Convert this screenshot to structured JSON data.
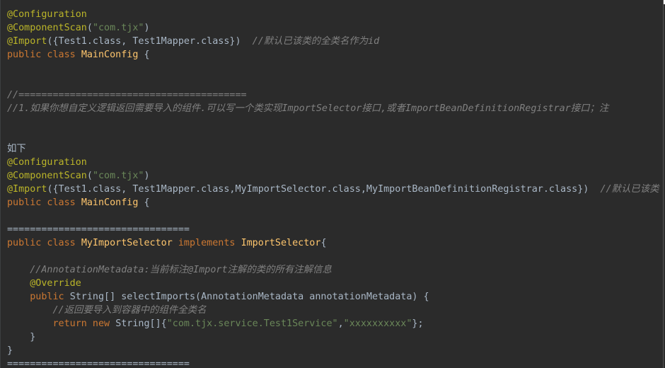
{
  "top_glyph": "ⓘ",
  "lines": [
    [
      {
        "t": "@Configuration",
        "c": "ann"
      }
    ],
    [
      {
        "t": "@ComponentScan",
        "c": "ann"
      },
      {
        "t": "(",
        "c": "pl"
      },
      {
        "t": "\"com.tjx\"",
        "c": "str"
      },
      {
        "t": ")",
        "c": "pl"
      }
    ],
    [
      {
        "t": "@Import",
        "c": "ann"
      },
      {
        "t": "({Test1.class, Test1Mapper.class})  ",
        "c": "pl"
      },
      {
        "t": "//默认已该类的全类名作为id",
        "c": "cm"
      }
    ],
    [
      {
        "t": "public class ",
        "c": "kw"
      },
      {
        "t": "MainConfig",
        "c": "cls"
      },
      {
        "t": " {",
        "c": "pl"
      }
    ],
    [],
    [],
    [
      {
        "t": "//========================================",
        "c": "cm"
      }
    ],
    [
      {
        "t": "//1.如果你想自定义逻辑返回需要导入的组件.可以写一个类实现ImportSelector接口,或者ImportBeanDefinitionRegistrar接口；注",
        "c": "cm"
      }
    ],
    [],
    [],
    [
      {
        "t": "如下",
        "c": "cn"
      }
    ],
    [
      {
        "t": "@Configuration",
        "c": "ann"
      }
    ],
    [
      {
        "t": "@ComponentScan",
        "c": "ann"
      },
      {
        "t": "(",
        "c": "pl"
      },
      {
        "t": "\"com.tjx\"",
        "c": "str"
      },
      {
        "t": ")",
        "c": "pl"
      }
    ],
    [
      {
        "t": "@Import",
        "c": "ann"
      },
      {
        "t": "({Test1.class, Test1Mapper.class,MyImportSelector.class,MyImportBeanDefinitionRegistrar.class})  ",
        "c": "pl"
      },
      {
        "t": "//默认已该类",
        "c": "cm"
      }
    ],
    [
      {
        "t": "public class ",
        "c": "kw"
      },
      {
        "t": "MainConfig",
        "c": "cls"
      },
      {
        "t": " {",
        "c": "pl"
      }
    ],
    [],
    [
      {
        "t": "================================",
        "c": "pl"
      }
    ],
    [
      {
        "t": "public class ",
        "c": "kw"
      },
      {
        "t": "MyImportSelector",
        "c": "cls"
      },
      {
        "t": " implements ",
        "c": "kw"
      },
      {
        "t": "ImportSelector",
        "c": "cls"
      },
      {
        "t": "{",
        "c": "pl"
      }
    ],
    [],
    [
      {
        "t": "    ",
        "c": "pl"
      },
      {
        "t": "//AnnotationMetadata:当前标注@Import注解的类的所有注解信息",
        "c": "cm"
      }
    ],
    [
      {
        "t": "    ",
        "c": "pl"
      },
      {
        "t": "@Override",
        "c": "ann"
      }
    ],
    [
      {
        "t": "    ",
        "c": "pl"
      },
      {
        "t": "public ",
        "c": "kw"
      },
      {
        "t": "String[] selectImports(AnnotationMetadata annotationMetadata) {",
        "c": "pl"
      }
    ],
    [
      {
        "t": "        ",
        "c": "pl"
      },
      {
        "t": "//返回要导入到容器中的组件全类名",
        "c": "cm"
      }
    ],
    [
      {
        "t": "        ",
        "c": "pl"
      },
      {
        "t": "return new ",
        "c": "kw"
      },
      {
        "t": "String[]{",
        "c": "pl"
      },
      {
        "t": "\"com.tjx.service.Test1Service\"",
        "c": "str"
      },
      {
        "t": ",",
        "c": "pl"
      },
      {
        "t": "\"xxxxxxxxxx\"",
        "c": "str"
      },
      {
        "t": "};",
        "c": "pl"
      }
    ],
    [
      {
        "t": "    }",
        "c": "pl"
      }
    ],
    [
      {
        "t": "}",
        "c": "pl"
      }
    ],
    [
      {
        "t": "================================",
        "c": "pl"
      }
    ]
  ]
}
